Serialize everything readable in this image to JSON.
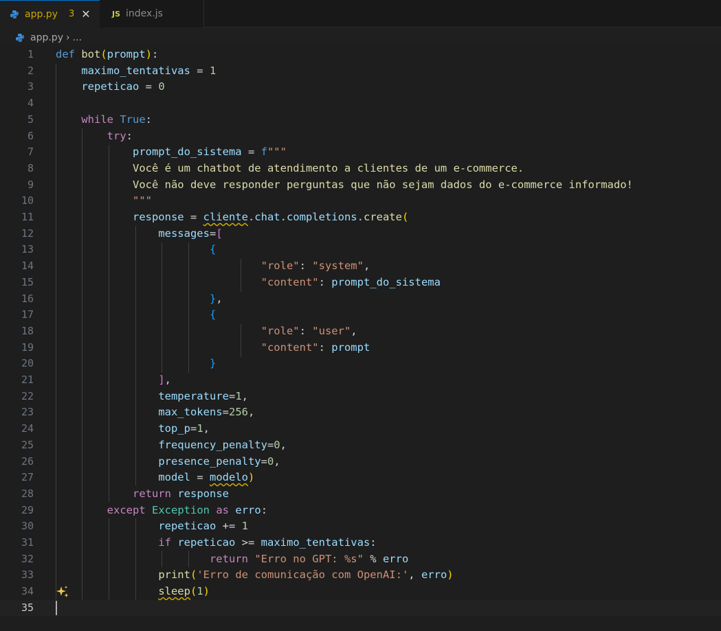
{
  "tabs": [
    {
      "label": "app.py",
      "badge": "3",
      "close": "✕",
      "icon": "python-icon",
      "active": true
    },
    {
      "label": "index.js",
      "icon_text": "JS",
      "icon": "javascript-icon",
      "active": false
    }
  ],
  "breadcrumb": {
    "file": "app.py",
    "separator": "›",
    "more": "..."
  },
  "code": {
    "line_numbers": [
      "1",
      "2",
      "3",
      "4",
      "5",
      "6",
      "7",
      "8",
      "9",
      "10",
      "11",
      "12",
      "13",
      "14",
      "15",
      "16",
      "17",
      "18",
      "19",
      "20",
      "21",
      "22",
      "23",
      "24",
      "25",
      "26",
      "27",
      "28",
      "29",
      "30",
      "31",
      "32",
      "33",
      "34",
      "35"
    ],
    "l1": {
      "kw": "def",
      "fn": "bot",
      "open": "(",
      "arg": "prompt",
      "close": ")",
      "colon": ":"
    },
    "l2": {
      "var": "maximo_tentativas",
      "op": " = ",
      "num": "1"
    },
    "l3": {
      "var": "repeticao",
      "op": " = ",
      "num": "0"
    },
    "l5": {
      "kw": "while",
      "val": "True",
      "colon": ":"
    },
    "l6": {
      "kw": "try",
      "colon": ":"
    },
    "l7": {
      "var": "prompt_do_sistema",
      "op": " = ",
      "prefix": "f",
      "str": "\"\"\""
    },
    "l8": {
      "str": "Você é um chatbot de atendimento a clientes de um e-commerce."
    },
    "l9": {
      "str": "Você não deve responder perguntas que não sejam dados do e-commerce informado!"
    },
    "l10": {
      "str": "\"\"\""
    },
    "l11": {
      "var": "response",
      "op": " = ",
      "obj": "cliente",
      "rest": ".chat.completions.",
      "fn": "create",
      "open": "("
    },
    "l12": {
      "param": "messages",
      "op": "=",
      "open": "["
    },
    "l13": {
      "open": "{"
    },
    "l14": {
      "key": "\"role\"",
      "colon": ": ",
      "val": "\"system\"",
      "comma": ","
    },
    "l15": {
      "key": "\"content\"",
      "colon": ": ",
      "val": "prompt_do_sistema"
    },
    "l16": {
      "close": "}",
      "comma": ","
    },
    "l17": {
      "open": "{"
    },
    "l18": {
      "key": "\"role\"",
      "colon": ": ",
      "val": "\"user\"",
      "comma": ","
    },
    "l19": {
      "key": "\"content\"",
      "colon": ": ",
      "val": "prompt"
    },
    "l20": {
      "close": "}"
    },
    "l21": {
      "close": "]",
      "comma": ","
    },
    "l22": {
      "param": "temperature",
      "op": "=",
      "num": "1",
      "comma": ","
    },
    "l23": {
      "param": "max_tokens",
      "op": "=",
      "num": "256",
      "comma": ","
    },
    "l24": {
      "param": "top_p",
      "op": "=",
      "num": "1",
      "comma": ","
    },
    "l25": {
      "param": "frequency_penalty",
      "op": "=",
      "num": "0",
      "comma": ","
    },
    "l26": {
      "param": "presence_penalty",
      "op": "=",
      "num": "0",
      "comma": ","
    },
    "l27": {
      "param": "model",
      "op": " = ",
      "val": "modelo",
      "close": ")"
    },
    "l28": {
      "kw": "return",
      "val": "response"
    },
    "l29": {
      "kw": "except",
      "type": "Exception",
      "as": "as",
      "var": "erro",
      "colon": ":"
    },
    "l30": {
      "var": "repeticao",
      "op": " += ",
      "num": "1"
    },
    "l31": {
      "kw": "if",
      "var": "repeticao",
      "op": " >= ",
      "var2": "maximo_tentativas",
      "colon": ":"
    },
    "l32": {
      "kw": "return",
      "str": "\"Erro no GPT: %s\"",
      "op": " % ",
      "var": "erro"
    },
    "l33": {
      "fn": "print",
      "open": "(",
      "str": "'Erro de comunicação com OpenAI:'",
      "comma": ", ",
      "var": "erro",
      "close": ")"
    },
    "l34": {
      "fn": "sleep",
      "open": "(",
      "num": "1",
      "close": ")"
    }
  },
  "colors": {
    "background": "#1e1e1e",
    "keyword": "#569cd6",
    "control": "#c586c0",
    "function": "#dcdcaa",
    "variable": "#9cdcfe",
    "string": "#ce9178",
    "number": "#b5cea8",
    "type": "#4ec9b0",
    "warning": "#cca700"
  }
}
